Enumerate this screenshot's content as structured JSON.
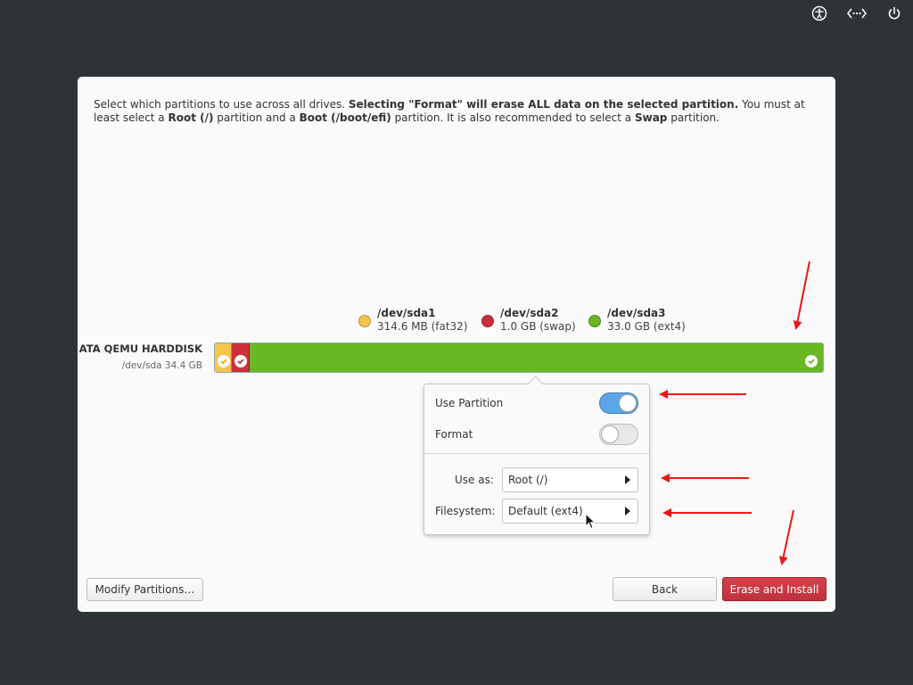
{
  "topbar": {
    "icons": [
      "accessibility-icon",
      "network-icon",
      "power-icon"
    ]
  },
  "intro": {
    "part1": "Select which partitions to use across all drives. ",
    "bold1": "Selecting \"Format\" will erase ALL data on the selected partition.",
    "part2": " You must at least select a ",
    "bold2": "Root (/)",
    "part3": " partition and a ",
    "bold3": "Boot (/boot/efi)",
    "part4": " partition. It is also recommended to select a ",
    "bold4": "Swap",
    "part5": " partition."
  },
  "legend": [
    {
      "name": "/dev/sda1",
      "info": "314.6 MB (fat32)",
      "color": "#f5c550"
    },
    {
      "name": "/dev/sda2",
      "info": "1.0 GB (swap)",
      "color": "#c9303a"
    },
    {
      "name": "/dev/sda3",
      "info": "33.0 GB (ext4)",
      "color": "#68b723"
    }
  ],
  "disk": {
    "name": "ATA QEMU HARDDISK",
    "info": "/dev/sda 34.4 GB"
  },
  "popover": {
    "use_partition_label": "Use Partition",
    "use_partition_on": true,
    "format_label": "Format",
    "format_on": false,
    "use_as_label": "Use as:",
    "use_as_value": "Root (/)",
    "filesystem_label": "Filesystem:",
    "filesystem_value": "Default (ext4)"
  },
  "buttons": {
    "modify": "Modify Partitions…",
    "back": "Back",
    "erase": "Erase and Install"
  },
  "colors": {
    "annotation_arrow": "#e81818",
    "background": "#2e3436",
    "accent": "#5aa6e6"
  }
}
